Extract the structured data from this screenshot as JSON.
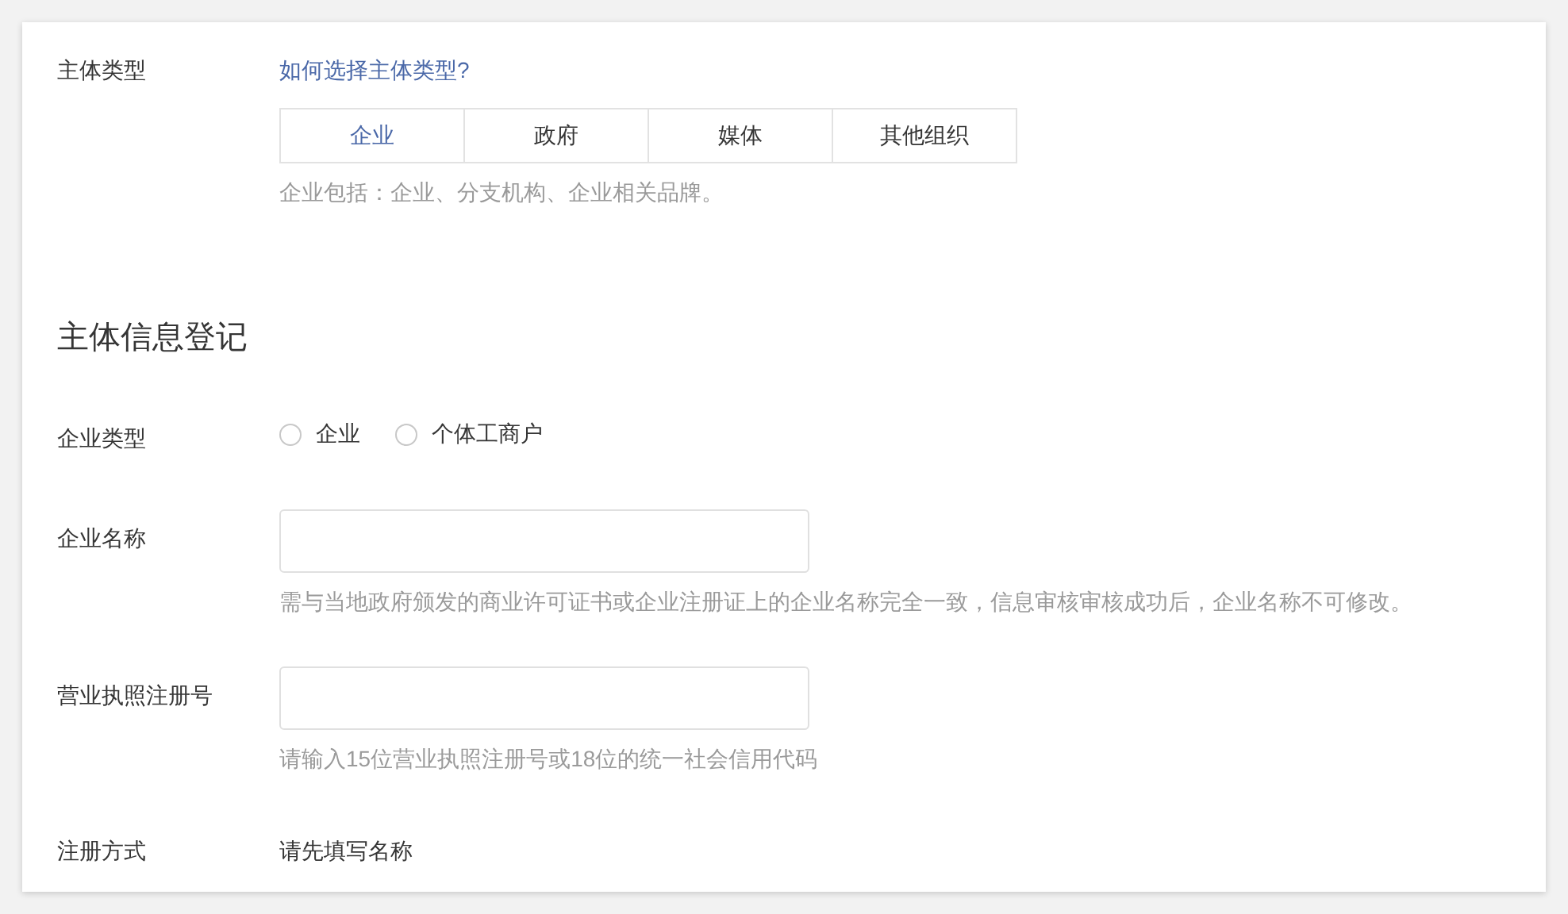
{
  "subject_type": {
    "label": "主体类型",
    "link": "如何选择主体类型?",
    "options": [
      {
        "label": "企业",
        "selected": true
      },
      {
        "label": "政府",
        "selected": false
      },
      {
        "label": "媒体",
        "selected": false
      },
      {
        "label": "其他组织",
        "selected": false
      }
    ],
    "hint": "企业包括：企业、分支机构、企业相关品牌。"
  },
  "registration": {
    "heading": "主体信息登记",
    "fields": [
      {
        "kind": "radio",
        "label": "企业类型",
        "options": [
          {
            "label": "企业",
            "selected": false
          },
          {
            "label": "个体工商户",
            "selected": false
          }
        ]
      },
      {
        "kind": "input",
        "label": "企业名称",
        "hint": "需与当地政府颁发的商业许可证书或企业注册证上的企业名称完全一致，信息审核审核成功后，企业名称不可修改。"
      },
      {
        "kind": "input",
        "label": "营业执照注册号",
        "hint": "请输入15位营业执照注册号或18位的统一社会信用代码"
      },
      {
        "kind": "text",
        "label": "注册方式",
        "value": "请先填写名称"
      }
    ]
  }
}
